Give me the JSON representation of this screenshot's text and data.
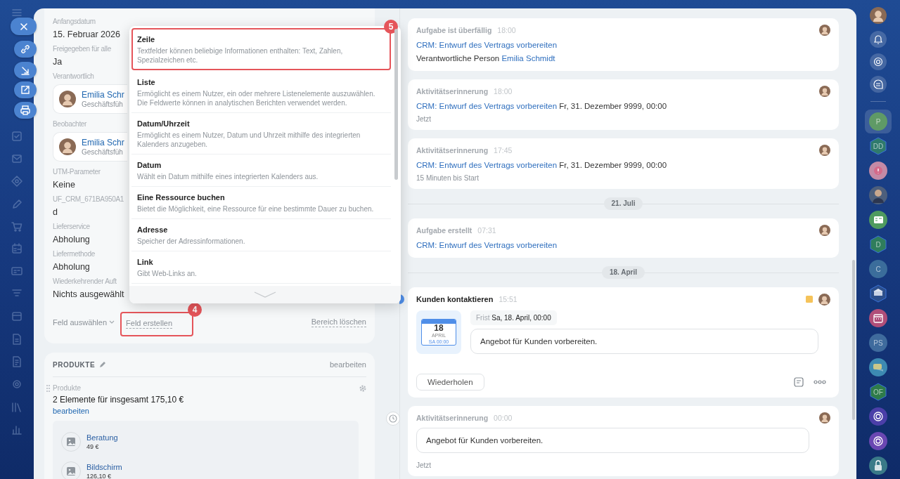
{
  "fields": [
    {
      "kind": "text",
      "label": "Anfangsdatum",
      "value": "15. Februar 2026"
    },
    {
      "kind": "text",
      "label": "Freigegeben für alle",
      "value": "Ja"
    },
    {
      "kind": "person",
      "label": "Verantwortlich",
      "name": "Emilia Schr",
      "role": "Geschäftsfüh"
    },
    {
      "kind": "person",
      "label": "Beobachter",
      "name": "Emilia Schr",
      "role": "Geschäftsfüh"
    },
    {
      "kind": "text",
      "label": "UTM-Parameter",
      "value": "Keine"
    },
    {
      "kind": "text",
      "label": "UF_CRM_671BA950A1",
      "value": "d"
    },
    {
      "kind": "text",
      "label": "Lieferservice",
      "value": "Abholung"
    },
    {
      "kind": "text",
      "label": "Liefermethode",
      "value": "Abholung"
    },
    {
      "kind": "text",
      "label": "Wiederkehrender Auft",
      "value": "Nichts ausgewählt"
    }
  ],
  "field_actions": {
    "select": "Feld auswählen",
    "create": "Feld erstellen",
    "create_callout": "4",
    "clear": "Bereich löschen"
  },
  "field_type_menu": {
    "items": [
      {
        "title": "Zeile",
        "description": "Textfelder können beliebige Informationen enthalten: Text, Zahlen, Spezialzeichen etc.",
        "callout": "5"
      },
      {
        "title": "Liste",
        "description": "Ermöglicht es einem Nutzer, ein oder mehrere Listenelemente auszuwählen. Die Feldwerte können in analytischen Berichten verwendet werden."
      },
      {
        "title": "Datum/Uhrzeit",
        "description": "Ermöglicht es einem Nutzer, Datum und Uhrzeit mithilfe des integrierten Kalenders anzugeben."
      },
      {
        "title": "Datum",
        "description": "Wählt ein Datum mithilfe eines integrierten Kalenders aus."
      },
      {
        "title": "Eine Ressource buchen",
        "description": "Bietet die Möglichkeit, eine Ressource für eine bestimmte Dauer zu buchen."
      },
      {
        "title": "Adresse",
        "description": "Speicher der Adressinformationen."
      },
      {
        "title": "Link",
        "description": "Gibt Web-Links an."
      }
    ]
  },
  "products": {
    "title": "PRODUKTE",
    "edit": "bearbeiten",
    "field_label": "Produkte",
    "summary": "2 Elemente für insgesamt 175,10 €",
    "summary_link": "bearbeiten",
    "items": [
      {
        "name": "Beratung",
        "price": "49 €"
      },
      {
        "name": "Bildschirm",
        "price": "126,10 €"
      }
    ]
  },
  "timeline": [
    {
      "kind": "event",
      "title": "Aufgabe ist überfällig",
      "time": "18:00",
      "link": "CRM: Entwurf des Vertrags vorbereiten",
      "detail": "Verantwortliche Person",
      "detail_link": "Emilia Schmidt"
    },
    {
      "kind": "event",
      "title": "Aktivitätserinnerung",
      "time": "18:00",
      "link": "CRM: Entwurf des Vertrags vorbereiten",
      "link_suffix": "Fr, 31. Dezember 9999, 00:00",
      "note": "Jetzt"
    },
    {
      "kind": "event",
      "title": "Aktivitätserinnerung",
      "time": "17:45",
      "link": "CRM: Entwurf des Vertrags vorbereiten",
      "link_suffix": "Fr, 31. Dezember 9999, 00:00",
      "note": "15 Minuten bis Start"
    },
    {
      "kind": "date",
      "label": "21. Juli"
    },
    {
      "kind": "event",
      "title": "Aufgabe erstellt",
      "time": "07:31",
      "link": "CRM: Entwurf des Vertrags vorbereiten"
    },
    {
      "kind": "date",
      "label": "18. April"
    },
    {
      "kind": "activity",
      "title": "Kunden kontaktieren",
      "time": "15:51",
      "calendar": {
        "day": "18",
        "month": "APRIL",
        "weekday_time": "SA 00:00"
      },
      "deadline_label": "Frist",
      "deadline": "Sa, 18. April, 00:00",
      "text": "Angebot für Kunden vorbereiten.",
      "button": "Wiederholen"
    },
    {
      "kind": "reminder",
      "title": "Aktivitätserinnerung",
      "time": "00:00",
      "text": "Angebot für Kunden vorbereiten.",
      "note": "Jetzt"
    }
  ],
  "right_sidebar": [
    {
      "kind": "circle",
      "label": "P",
      "color": "#5f9a66",
      "selected": true
    },
    {
      "kind": "hexagon",
      "label": "DD",
      "color": "#2f7a6c",
      "selected": false
    },
    {
      "kind": "alert",
      "color": "#c48aa6",
      "selected": false
    },
    {
      "kind": "avatar",
      "color": "#4d5f7c",
      "selected": false
    },
    {
      "kind": "card",
      "color": "#4f9b5f",
      "selected": false
    },
    {
      "kind": "hexagon",
      "label": "D",
      "color": "#2f7d5c",
      "selected": false
    },
    {
      "kind": "circle",
      "label": "C",
      "color": "#3b6d9b",
      "selected": false
    },
    {
      "kind": "logo",
      "color": "#2c4f8c",
      "selected": false
    },
    {
      "kind": "calendar",
      "color": "#b04e79",
      "selected": false
    },
    {
      "kind": "circle",
      "label": "PS",
      "color": "#3f6b9d",
      "selected": false
    },
    {
      "kind": "chat",
      "color": "#3d8ab2",
      "selected": false
    },
    {
      "kind": "hexagon",
      "label": "OF",
      "color": "#2e7b4a",
      "selected": false
    },
    {
      "kind": "swirl",
      "color": "#4b3fa8",
      "selected": false
    },
    {
      "kind": "swirl",
      "color": "#6a47b2",
      "selected": false
    },
    {
      "kind": "lock",
      "color": "#3a7a88",
      "selected": false
    }
  ]
}
